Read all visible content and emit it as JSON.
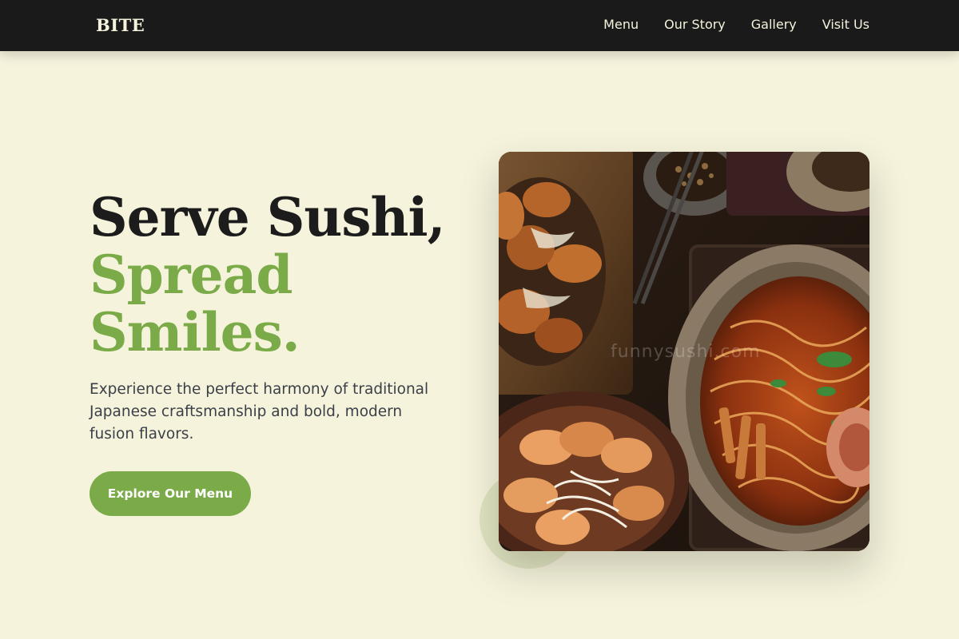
{
  "brand": {
    "name": "BITE"
  },
  "nav": {
    "items": [
      {
        "label": "Menu"
      },
      {
        "label": "Our Story"
      },
      {
        "label": "Gallery"
      },
      {
        "label": "Visit Us"
      }
    ]
  },
  "hero": {
    "headline_line1": "Serve Sushi,",
    "headline_line2": "Spread",
    "headline_line3": "Smiles.",
    "description": "Experience the perfect harmony of traditional Japanese craftsmanship and bold, modern fusion flavors.",
    "cta_label": "Explore Our Menu",
    "image_watermark": "funnysushi.com"
  },
  "colors": {
    "background": "#f5f3dc",
    "nav_background": "#1a1a1a",
    "accent_green": "#7aab48",
    "headline_dark": "#1c1c1c",
    "body_text": "#3b3f48"
  }
}
